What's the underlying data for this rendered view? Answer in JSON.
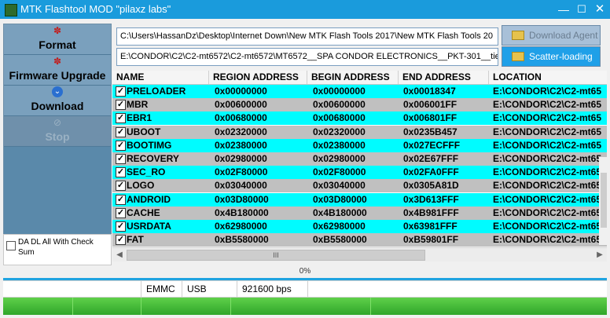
{
  "window": {
    "title": "MTK Flashtool MOD \"pilaxz labs\"",
    "minimize": "—",
    "maximize": "☐",
    "close": "✕"
  },
  "sidebar": {
    "buttons": [
      {
        "label": "Format",
        "icon": "format-icon",
        "enabled": true
      },
      {
        "label": "Firmware Upgrade",
        "icon": "firmware-upgrade-icon",
        "enabled": true
      },
      {
        "label": "Download",
        "icon": "download-icon",
        "enabled": true
      },
      {
        "label": "Stop",
        "icon": "stop-icon",
        "enabled": false
      }
    ],
    "da_checkbox": {
      "label": "DA DL All With Check Sum",
      "checked": false
    }
  },
  "paths": {
    "download_agent": "C:\\Users\\HassanDz\\Desktop\\Internet Down\\New MTK Flash Tools 2017\\New MTK Flash Tools 20",
    "scatter": "E:\\CONDOR\\C2\\C2-mt6572\\C2-mt6572\\MT6572__SPA CONDOR ELECTRONICS__PKT-301__tie"
  },
  "actions": {
    "download_agent": "Download Agent",
    "scatter_loading": "Scatter-loading"
  },
  "table": {
    "columns": [
      "NAME",
      "REGION ADDRESS",
      "BEGIN ADDRESS",
      "END ADDRESS",
      "LOCATION"
    ],
    "rows": [
      {
        "name": "PRELOADER",
        "region": "0x00000000",
        "begin": "0x00000000",
        "end": "0x00018347",
        "location": "E:\\CONDOR\\C2\\C2-mt65",
        "checked": true
      },
      {
        "name": "MBR",
        "region": "0x00600000",
        "begin": "0x00600000",
        "end": "0x006001FF",
        "location": "E:\\CONDOR\\C2\\C2-mt65",
        "checked": true
      },
      {
        "name": "EBR1",
        "region": "0x00680000",
        "begin": "0x00680000",
        "end": "0x006801FF",
        "location": "E:\\CONDOR\\C2\\C2-mt65",
        "checked": true
      },
      {
        "name": "UBOOT",
        "region": "0x02320000",
        "begin": "0x02320000",
        "end": "0x0235B457",
        "location": "E:\\CONDOR\\C2\\C2-mt65",
        "checked": true
      },
      {
        "name": "BOOTIMG",
        "region": "0x02380000",
        "begin": "0x02380000",
        "end": "0x027ECFFF",
        "location": "E:\\CONDOR\\C2\\C2-mt65",
        "checked": true
      },
      {
        "name": "RECOVERY",
        "region": "0x02980000",
        "begin": "0x02980000",
        "end": "0x02E67FFF",
        "location": "E:\\CONDOR\\C2\\C2-mt65",
        "checked": true
      },
      {
        "name": "SEC_RO",
        "region": "0x02F80000",
        "begin": "0x02F80000",
        "end": "0x02FA0FFF",
        "location": "E:\\CONDOR\\C2\\C2-mt65",
        "checked": true
      },
      {
        "name": "LOGO",
        "region": "0x03040000",
        "begin": "0x03040000",
        "end": "0x0305A81D",
        "location": "E:\\CONDOR\\C2\\C2-mt65",
        "checked": true
      },
      {
        "name": "ANDROID",
        "region": "0x03D80000",
        "begin": "0x03D80000",
        "end": "0x3D613FFF",
        "location": "E:\\CONDOR\\C2\\C2-mt65",
        "checked": true
      },
      {
        "name": "CACHE",
        "region": "0x4B180000",
        "begin": "0x4B180000",
        "end": "0x4B981FFF",
        "location": "E:\\CONDOR\\C2\\C2-mt65",
        "checked": true
      },
      {
        "name": "USRDATA",
        "region": "0x62980000",
        "begin": "0x62980000",
        "end": "0x63981FFF",
        "location": "E:\\CONDOR\\C2\\C2-mt65",
        "checked": true
      },
      {
        "name": "FAT",
        "region": "0xB5580000",
        "begin": "0xB5580000",
        "end": "0xB59801FF",
        "location": "E:\\CONDOR\\C2\\C2-mt65",
        "checked": true
      }
    ]
  },
  "scrollbar": {
    "left_arrow": "◀",
    "right_arrow": "▶",
    "grip": "III"
  },
  "progress": {
    "text": "0%",
    "value": 0
  },
  "status": {
    "storage": "EMMC",
    "port": "USB",
    "baud": "921600 bps"
  },
  "colors": {
    "titlebar": "#1a9bdc",
    "row_cyan": "#00fcff",
    "row_gray": "#c0c0c0",
    "scatter_button": "#1fa0e8",
    "progress_green": "#3ab832"
  }
}
